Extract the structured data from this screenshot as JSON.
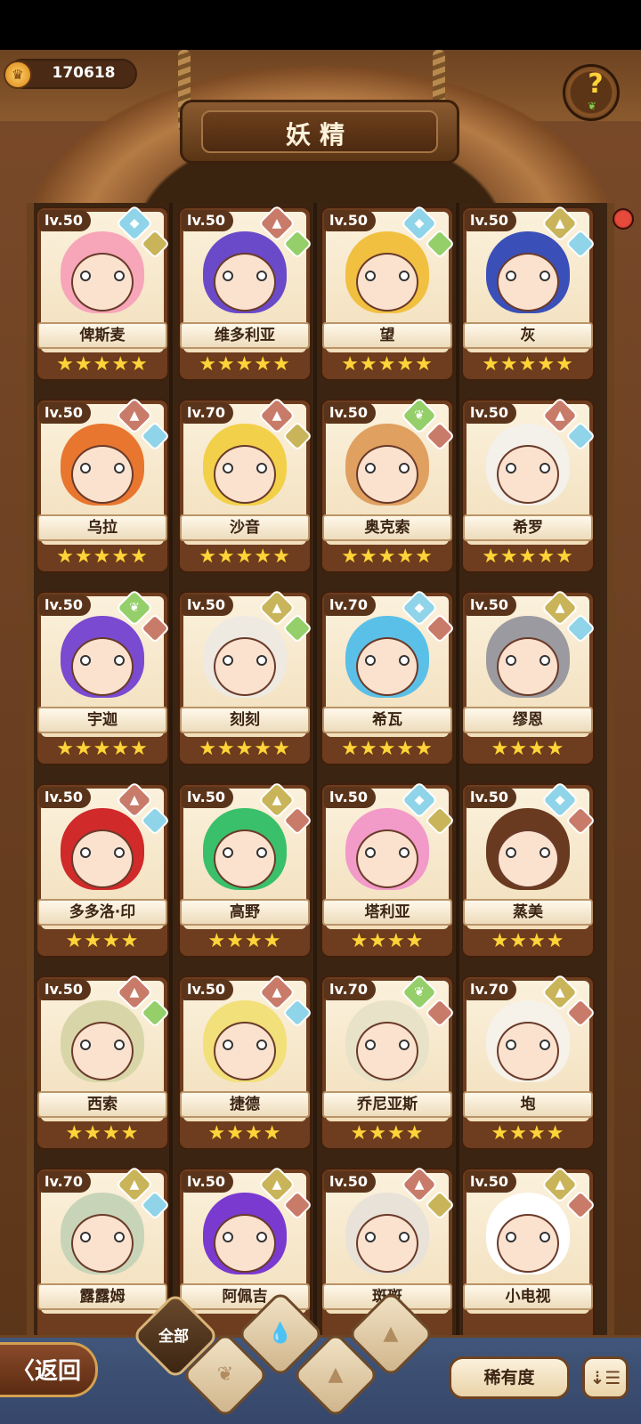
{
  "header": {
    "currency_value": "170618",
    "title": "妖精",
    "help_symbol": "?"
  },
  "cards": [
    {
      "level": "lv.50",
      "name": "俾斯麦",
      "stars": "★★★★★",
      "elements": [
        "water",
        "earth"
      ],
      "hair": "#f6a6b8"
    },
    {
      "level": "lv.50",
      "name": "维多利亚",
      "stars": "★★★★★",
      "elements": [
        "fire",
        "wind"
      ],
      "hair": "#6a4ac8"
    },
    {
      "level": "lv.50",
      "name": "望",
      "stars": "★★★★★",
      "elements": [
        "water",
        "wind"
      ],
      "hair": "#f2c040"
    },
    {
      "level": "lv.50",
      "name": "灰",
      "stars": "★★★★★",
      "elements": [
        "earth",
        "water"
      ],
      "hair": "#3a50b8"
    },
    {
      "level": "lv.50",
      "name": "乌拉",
      "stars": "★★★★★",
      "elements": [
        "fire",
        "water"
      ],
      "hair": "#e8762e"
    },
    {
      "level": "lv.70",
      "name": "沙音",
      "stars": "★★★★★",
      "elements": [
        "fire",
        "earth"
      ],
      "hair": "#f2d04a"
    },
    {
      "level": "lv.50",
      "name": "奥克索",
      "stars": "★★★★★",
      "elements": [
        "wind",
        "fire"
      ],
      "hair": "#e0a060"
    },
    {
      "level": "lv.50",
      "name": "希罗",
      "stars": "★★★★★",
      "elements": [
        "fire",
        "water"
      ],
      "hair": "#f4f0ea"
    },
    {
      "level": "lv.50",
      "name": "宇迦",
      "stars": "★★★★★",
      "elements": [
        "wind",
        "fire"
      ],
      "hair": "#7a4ad0"
    },
    {
      "level": "lv.50",
      "name": "刻刻",
      "stars": "★★★★★",
      "elements": [
        "earth",
        "wind"
      ],
      "hair": "#eeeae2"
    },
    {
      "level": "lv.70",
      "name": "希瓦",
      "stars": "★★★★★",
      "elements": [
        "water",
        "fire"
      ],
      "hair": "#5ac0e8"
    },
    {
      "level": "lv.50",
      "name": "缪恩",
      "stars": "★★★★",
      "elements": [
        "earth",
        "water"
      ],
      "hair": "#9a9aa0"
    },
    {
      "level": "lv.50",
      "name": "多多洛·印",
      "stars": "★★★★",
      "elements": [
        "fire",
        "water"
      ],
      "hair": "#d02a2a"
    },
    {
      "level": "lv.50",
      "name": "高野",
      "stars": "★★★★",
      "elements": [
        "earth",
        "fire"
      ],
      "hair": "#3ac06a"
    },
    {
      "level": "lv.50",
      "name": "塔利亚",
      "stars": "★★★★",
      "elements": [
        "water",
        "earth"
      ],
      "hair": "#f29ac8"
    },
    {
      "level": "lv.50",
      "name": "蒸美",
      "stars": "★★★★",
      "elements": [
        "water",
        "fire"
      ],
      "hair": "#6a3a20"
    },
    {
      "level": "lv.50",
      "name": "西索",
      "stars": "★★★★",
      "elements": [
        "fire",
        "wind"
      ],
      "hair": "#d8d6a8"
    },
    {
      "level": "lv.50",
      "name": "捷德",
      "stars": "★★★★",
      "elements": [
        "fire",
        "water"
      ],
      "hair": "#f2e07a"
    },
    {
      "level": "lv.70",
      "name": "乔尼亚斯",
      "stars": "★★★★",
      "elements": [
        "wind",
        "fire"
      ],
      "hair": "#e8e2c8"
    },
    {
      "level": "lv.70",
      "name": "垉",
      "stars": "★★★★",
      "elements": [
        "earth",
        "fire"
      ],
      "hair": "#f6f2ea"
    },
    {
      "level": "lv.70",
      "name": "露露姆",
      "stars": "",
      "elements": [
        "earth",
        "water"
      ],
      "hair": "#c8d4b8"
    },
    {
      "level": "lv.50",
      "name": "阿佩吉",
      "stars": "",
      "elements": [
        "earth",
        "fire"
      ],
      "hair": "#7a3ad0"
    },
    {
      "level": "lv.50",
      "name": "斑斑",
      "stars": "",
      "elements": [
        "fire",
        "earth"
      ],
      "hair": "#e8e2d8"
    },
    {
      "level": "lv.50",
      "name": "小电视",
      "stars": "",
      "elements": [
        "earth",
        "fire"
      ],
      "hair": "#ffffff"
    }
  ],
  "footer": {
    "back_label": "〈返回",
    "filter_all_label": "全部",
    "rarity_label": "稀有度",
    "sort_symbol": "⇣☰"
  }
}
